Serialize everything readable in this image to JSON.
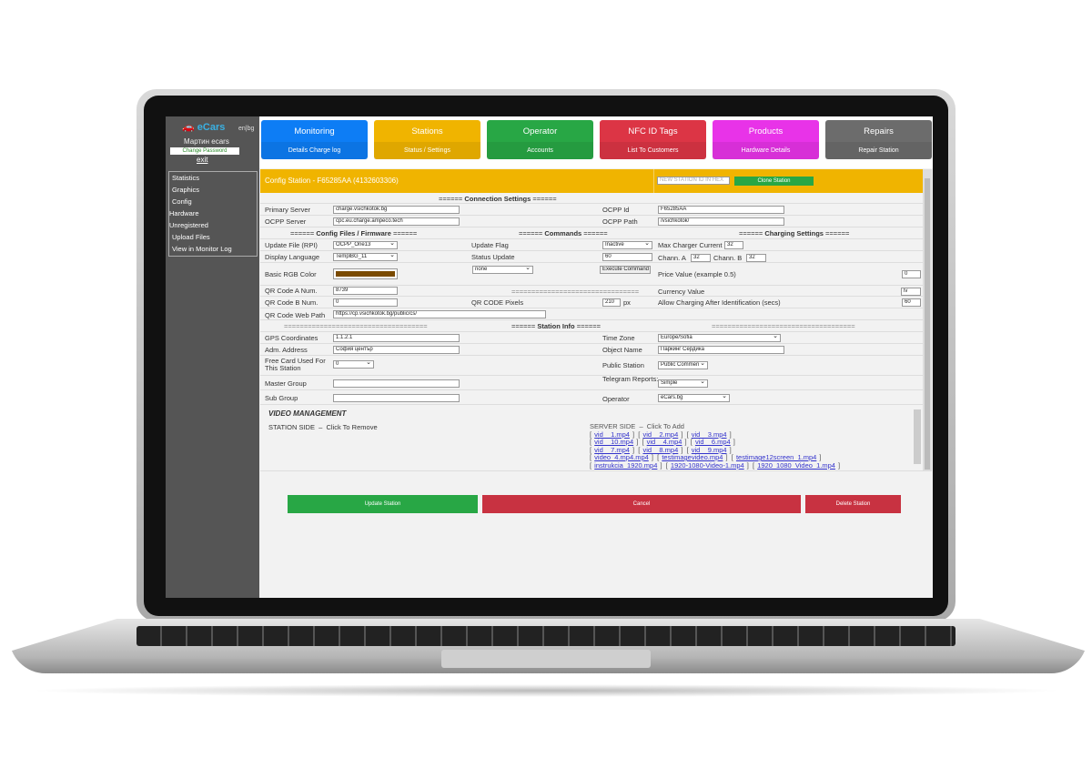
{
  "sidebar": {
    "logo": "eCars",
    "lang": "en|bg",
    "user": "Мартин ecars",
    "change_password": "Change Password",
    "exit": "exit",
    "items": [
      "Statistics",
      "Graphics",
      "Config",
      "Hardware",
      "Unregistered",
      "Upload Files",
      "View in Monitor Log"
    ]
  },
  "tabs": [
    {
      "title": "Monitoring",
      "sub": "Details Charge log",
      "color": "#0d7df5"
    },
    {
      "title": "Stations",
      "sub": "Status / Settings",
      "color": "#f0b400"
    },
    {
      "title": "Operator",
      "sub": "Accounts",
      "color": "#28a745"
    },
    {
      "title": "NFC ID Tags",
      "sub": "List To Customers",
      "color": "#dc3545"
    },
    {
      "title": "Products",
      "sub": "Hardware Details",
      "color": "#e833e8"
    },
    {
      "title": "Repairs",
      "sub": "Repair Station",
      "color": "#6c6c6c"
    }
  ],
  "header": {
    "title": "Config Station - F65285AA (4132603306)",
    "new_id_placeholder": "NEW STATION ID IN HEX",
    "clone": "Clone Station"
  },
  "connection": {
    "heading": "Connection Settings",
    "primary_server_label": "Primary Server",
    "primary_server": "charge.vsichkotok.bg",
    "ocpp_server_label": "OCPP Server",
    "ocpp_server": "cpc.eu.charge.ampeco.tech",
    "ocpp_id_label": "OCPP Id",
    "ocpp_id": "F65285AA",
    "ocpp_path_label": "OCPP Path",
    "ocpp_path": "/vsichkotok/"
  },
  "firmware": {
    "heading": "Config Files / Firmware",
    "update_file_label": "Update File (RPI)",
    "update_file": "OCPP_One13",
    "display_language_label": "Display Language",
    "display_language": "TemplBG_11",
    "rgb_label": "Basic RGB Color",
    "rgb_color": "#7a4a00",
    "qr_a_label": "QR Code A Num.",
    "qr_a": "8739",
    "qr_b_label": "QR Code B Num.",
    "qr_b": "0",
    "qr_path_label": "QR Code Web Path",
    "qr_path": "https://cp.vsichkotok.bg/public/cs/"
  },
  "commands": {
    "heading": "Commands",
    "update_flag_label": "Update Flag",
    "update_flag": "Inactive",
    "status_update_label": "Status Update",
    "status_update": "60",
    "command": "none",
    "execute": "Execute Command",
    "qr_pixels_label": "QR CODE Pixels",
    "qr_pixels": "210",
    "px": "px"
  },
  "charging": {
    "heading": "Charging Settings",
    "max_current_label": "Max Charger Current",
    "max_current": "32",
    "chann_a_label": "Chann. A",
    "chann_a": "32",
    "chann_b_label": "Chann. B",
    "chann_b": "32",
    "price_label": "Price Value (example 0.5)",
    "price": "0",
    "currency_label": "Currency Value",
    "currency": "lv",
    "allow_label": "Allow Charging After Identification (secs)",
    "allow": "60"
  },
  "info": {
    "heading": "Station Info",
    "gps_label": "GPS Coordinates",
    "gps": "1.1.2.1",
    "address_label": "Adm. Address",
    "address": "София център",
    "free_card_label": "Free Card Used For This Station",
    "free_card": "0",
    "master_label": "Master Group",
    "master": "",
    "sub_label": "Sub Group",
    "sub": "",
    "tz_label": "Time Zone",
    "tz": "Europe/Sofia",
    "object_label": "Object Name",
    "object": "Паркинг Сердика",
    "public_label": "Public Station",
    "public": "Public Commen",
    "telegram_label": "Telegram Reports:",
    "telegram": "Simple",
    "operator_label": "Operator",
    "operator": "eCars.bg"
  },
  "video": {
    "heading": "VIDEO MANAGEMENT",
    "station_side": "STATION SIDE  –  Click To Remove",
    "server_side": "SERVER SIDE  –  Click To Add",
    "files": [
      [
        "vid__1.mp4",
        "vid__2.mp4",
        "vid__3.mp4"
      ],
      [
        "vid__10.mp4",
        "vid__4.mp4",
        "vid__6.mp4"
      ],
      [
        "vid__7.mp4",
        "vid__8.mp4",
        "vid__9.mp4"
      ],
      [
        "video_4.mp4.mp4",
        "testimagevideo.mp4",
        "testimage12screen_1.mp4"
      ],
      [
        "instrukcia_1920.mp4",
        "1920-1080-Video-1.mp4",
        "1920_1080_Video_1.mp4"
      ]
    ]
  },
  "actions": {
    "update": "Update Station",
    "cancel": "Cancel",
    "delete": "Delete Station",
    "update_color": "#28a745",
    "cancel_color": "#c83241"
  }
}
